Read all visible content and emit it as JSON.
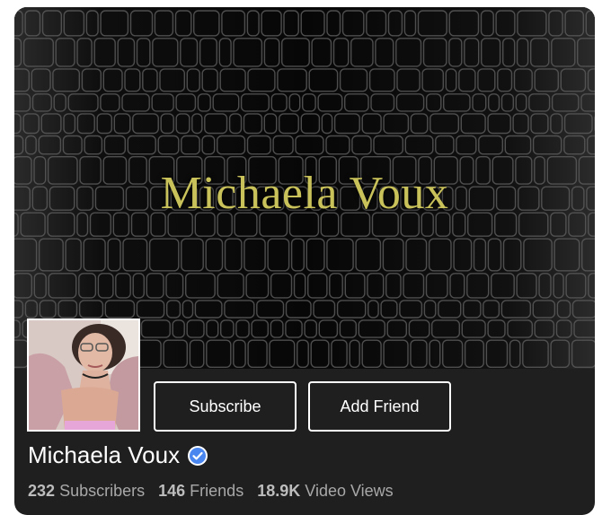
{
  "cover": {
    "title": "Michaela Voux",
    "background_texture": "black-crocodile-leather"
  },
  "profile": {
    "name": "Michaela Voux",
    "verified": true,
    "verified_icon": "checkmark-badge-icon",
    "accent_color": "#4a86f0"
  },
  "actions": {
    "subscribe_label": "Subscribe",
    "add_friend_label": "Add Friend"
  },
  "stats": {
    "subscribers_count": "232",
    "subscribers_label": "Subscribers",
    "friends_count": "146",
    "friends_label": "Friends",
    "views_count": "18.9K",
    "views_label": "Video Views"
  },
  "colors": {
    "card_bg": "#1f1f1f",
    "cover_title": "#c9c25a",
    "text_primary": "#ffffff",
    "text_secondary": "#a8a8a8"
  }
}
